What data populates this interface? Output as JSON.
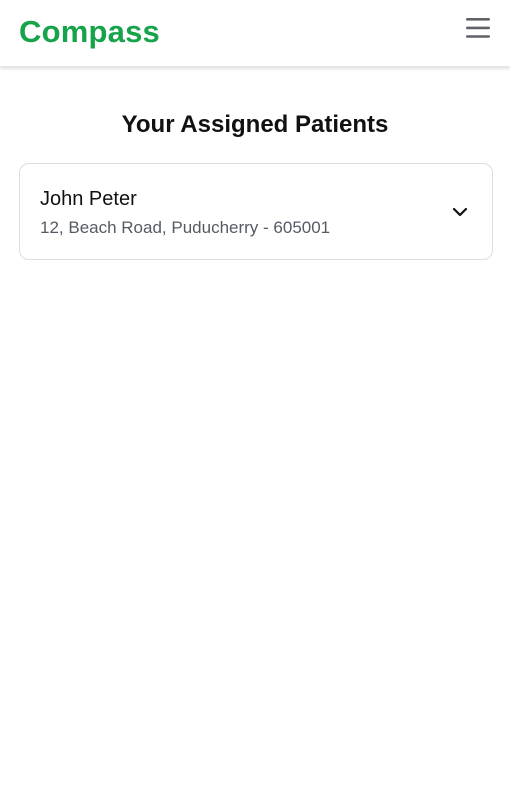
{
  "header": {
    "brand": "Compass",
    "brand_color": "#16a34a",
    "menu_icon": "hamburger-menu-icon"
  },
  "main": {
    "title": "Your Assigned Patients",
    "patients": [
      {
        "name": "John Peter",
        "address": "12, Beach Road, Puducherry - 605001",
        "expand_icon": "chevron-down-icon"
      }
    ]
  }
}
